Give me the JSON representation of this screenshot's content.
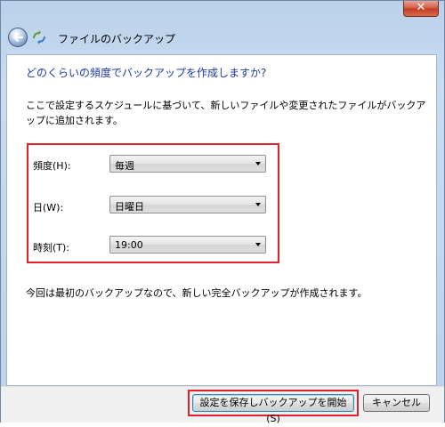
{
  "window": {
    "close_label": "✕",
    "title": "ファイルのバックアップ"
  },
  "content": {
    "question": "どのくらいの頻度でバックアップを作成しますか?",
    "description": "ここで設定するスケジュールに基づいて、新しいファイルや変更されたファイルがバックアップに追加されます。",
    "fields": [
      {
        "label": "頻度(H):",
        "value": "毎週"
      },
      {
        "label": "日(W):",
        "value": "日曜日"
      },
      {
        "label": "時刻(T):",
        "value": "19:00"
      }
    ],
    "note": "今回は最初のバックアップなので、新しい完全バックアップが作成されます。"
  },
  "footer": {
    "save_label": "設定を保存しバックアップを開始(S)",
    "cancel_label": "キャンセル"
  },
  "colors": {
    "highlight": "#e0202a",
    "question_text": "#1d3a9e"
  },
  "icons": [
    "back-arrow-icon",
    "backup-app-icon",
    "close-icon",
    "dropdown-arrow-icon"
  ]
}
